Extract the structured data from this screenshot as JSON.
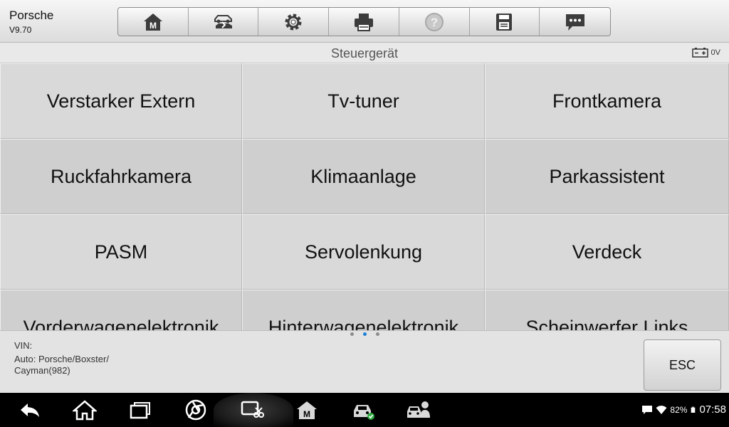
{
  "header": {
    "brand": "Porsche",
    "version": "V9.70",
    "toolbar": [
      {
        "name": "home-m-icon"
      },
      {
        "name": "vehicle-swap-icon"
      },
      {
        "name": "gear-icon"
      },
      {
        "name": "printer-icon"
      },
      {
        "name": "help-icon"
      },
      {
        "name": "save-icon"
      },
      {
        "name": "chat-icon"
      }
    ]
  },
  "titlebar": {
    "title": "Steuergerät",
    "battery_voltage": "0V"
  },
  "modules": [
    "Verstarker Extern",
    "Tv-tuner",
    "Frontkamera",
    "Ruckfahrkamera",
    "Klimaanlage",
    "Parkassistent",
    "PASM",
    "Servolenkung",
    "Verdeck",
    "Vorderwagenelektronik",
    "Hinterwagenelektronik",
    "Scheinwerfer Links"
  ],
  "pager": {
    "pages": 3,
    "active": 2
  },
  "info": {
    "vin_label": "VIN:",
    "auto": "Auto: Porsche/Boxster/ Cayman(982)"
  },
  "esc_label": "ESC",
  "status": {
    "battery_percent": "82%",
    "time": "07:58"
  },
  "colors": {
    "accent": "#1e7fd6",
    "cell": "#d9d9d9",
    "cell_alt": "#cfcfcf"
  }
}
